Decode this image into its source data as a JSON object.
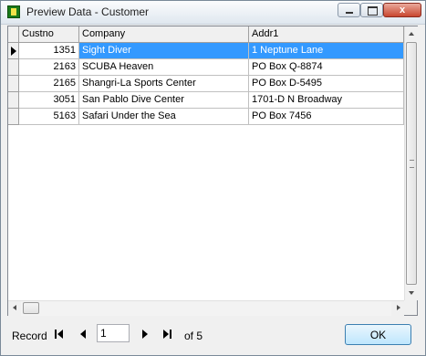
{
  "window": {
    "title": "Preview Data - Customer",
    "close_glyph": "x"
  },
  "grid": {
    "columns": [
      "Custno",
      "Company",
      "Addr1"
    ],
    "rows": [
      {
        "custno": "1351",
        "company": "Sight Diver",
        "addr1": "1 Neptune Lane",
        "selected": true
      },
      {
        "custno": "2163",
        "company": "SCUBA Heaven",
        "addr1": "PO Box Q-8874",
        "selected": false
      },
      {
        "custno": "2165",
        "company": "Shangri-La Sports Center",
        "addr1": "PO Box D-5495",
        "selected": false
      },
      {
        "custno": "3051",
        "company": "San Pablo Dive Center",
        "addr1": "1701-D N Broadway",
        "selected": false
      },
      {
        "custno": "5163",
        "company": "Safari Under the Sea",
        "addr1": "PO Box 7456",
        "selected": false
      }
    ]
  },
  "navigator": {
    "record_label": "Record",
    "current_record": "1",
    "total_label": "of 5"
  },
  "buttons": {
    "ok_label": "OK"
  },
  "colors": {
    "selection": "#3399ff",
    "ok_border": "#3c7fb1"
  }
}
